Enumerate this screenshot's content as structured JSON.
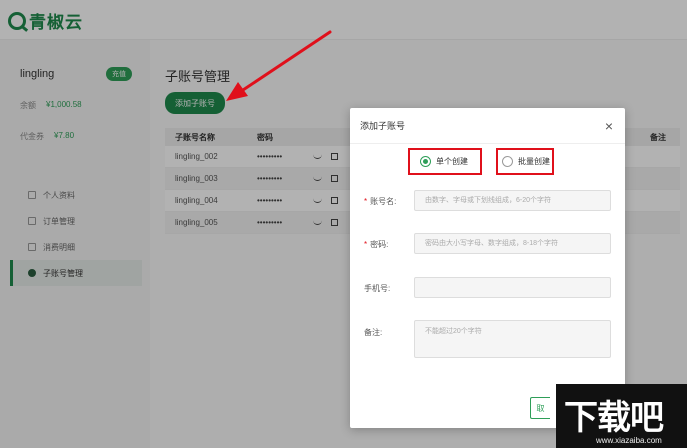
{
  "brand": {
    "name": "青椒云"
  },
  "sidebar": {
    "username": "lingling",
    "recharge_label": "充值",
    "balance_label": "余额",
    "balance_value": "¥1,000.58",
    "voucher_label": "代金券",
    "voucher_value": "¥7.80",
    "items": [
      {
        "label": "个人资料",
        "icon": "person-icon"
      },
      {
        "label": "订单管理",
        "icon": "order-icon"
      },
      {
        "label": "消费明细",
        "icon": "list-icon"
      },
      {
        "label": "子账号管理",
        "icon": "sub-account-icon"
      }
    ]
  },
  "main": {
    "title": "子账号管理",
    "add_button": "添加子账号",
    "columns": {
      "name": "子账号名称",
      "password": "密码",
      "note": "备注"
    },
    "rows": [
      {
        "name": "lingling_002",
        "password": "•••••••••"
      },
      {
        "name": "lingling_003",
        "password": "•••••••••"
      },
      {
        "name": "lingling_004",
        "password": "•••••••••"
      },
      {
        "name": "lingling_005",
        "password": "•••••••••"
      }
    ]
  },
  "modal": {
    "title": "添加子账号",
    "close": "×",
    "options": {
      "single": "单个创建",
      "batch": "批量创建"
    },
    "fields": {
      "account_label": "账号名:",
      "account_placeholder": "由数字、字母或下划线组成，6-20个字符",
      "password_label": "密码:",
      "password_placeholder": "密码由大小写字母、数字组成，8-18个字符",
      "phone_label": "手机号:",
      "phone_placeholder": "",
      "note_label": "备注:",
      "note_placeholder": "不能超过20个字符"
    },
    "required_mark": "*",
    "cancel_label": "取"
  },
  "watermark": {
    "big": "下载吧",
    "small": "www.xiazaiba.com"
  },
  "colors": {
    "brand_green": "#1f8a4c",
    "highlight_red": "#e0101b"
  }
}
